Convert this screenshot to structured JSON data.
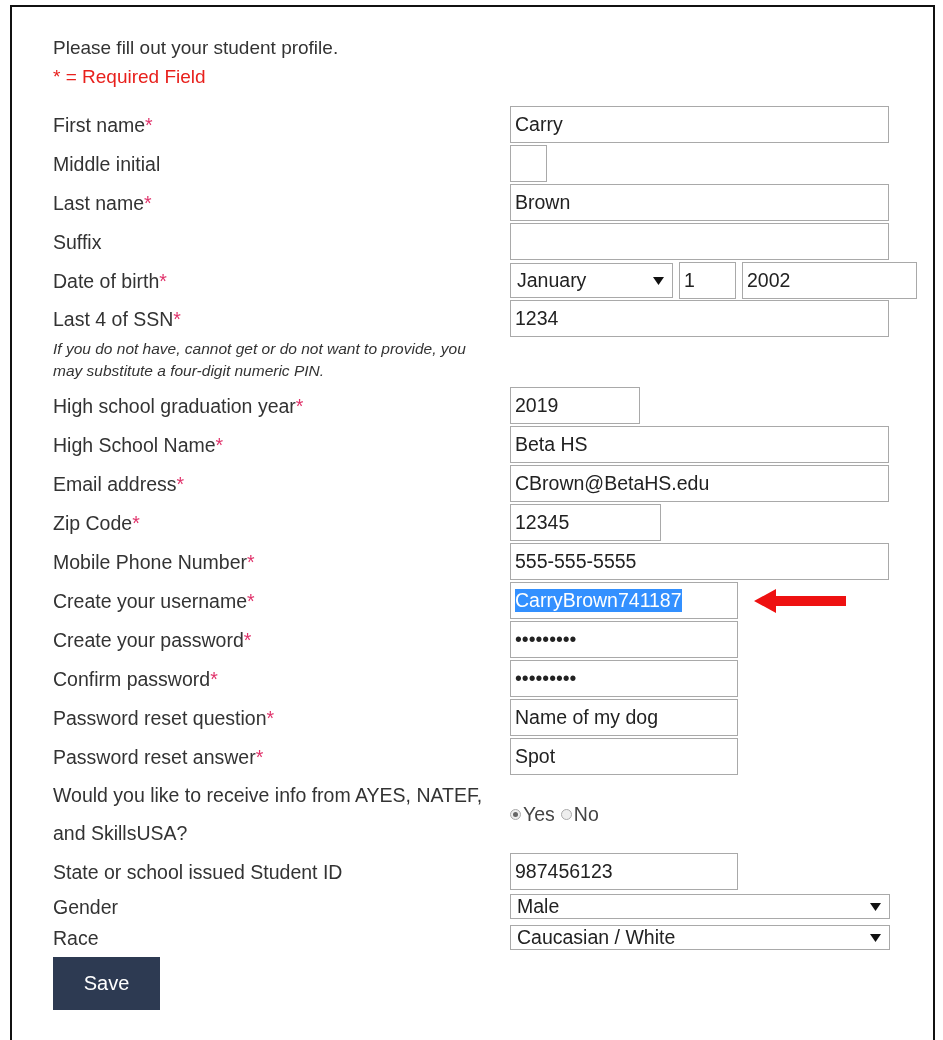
{
  "intro": "Please fill out your student profile.",
  "legend": "* = Required Field",
  "rows": [
    {
      "kind": "text",
      "label": "First name",
      "marker": "*",
      "value": "Carry"
    },
    {
      "kind": "text",
      "label": "Middle initial"
    },
    {
      "kind": "text",
      "label": "Last name",
      "marker": "*",
      "value": "Brown"
    },
    {
      "kind": "text",
      "label": "Suffix"
    },
    {
      "kind": "date",
      "label": "Date of birth",
      "marker": "*",
      "month": "January",
      "day": "1",
      "year": "2002"
    },
    {
      "kind": "text",
      "label": "Last 4 of SSN",
      "marker": "*",
      "note": "If you do not have, cannot get or do not want to provide, you may substitute a four-digit numeric PIN.",
      "value": "1234"
    },
    {
      "kind": "text",
      "label": "High school graduation year",
      "marker": "*",
      "value": "2019"
    },
    {
      "kind": "text",
      "label": "High School Name",
      "marker": "*",
      "value": "Beta HS"
    },
    {
      "kind": "text",
      "label": "Email address",
      "marker": "*",
      "value": "CBrown@BetaHS.edu"
    },
    {
      "kind": "text",
      "label": "Zip Code",
      "marker": "*",
      "value": "12345"
    },
    {
      "kind": "text",
      "label": "Mobile Phone Number",
      "marker": "*",
      "value": "555-555-5555"
    },
    {
      "kind": "text",
      "label": "Create your username",
      "marker": "*",
      "value": "CarryBrown741187",
      "highlighted": true
    },
    {
      "kind": "text",
      "label": "Create your password",
      "marker": "*",
      "value": "•••••••••"
    },
    {
      "kind": "text",
      "label": "Confirm password",
      "marker": "*",
      "value": "•••••••••"
    },
    {
      "kind": "text",
      "label": "Password reset question",
      "marker": "*",
      "value": "Name of my dog"
    },
    {
      "kind": "text",
      "label": "Password reset answer",
      "marker": "*",
      "value": "Spot"
    },
    {
      "kind": "radio",
      "label": "Would you like to receive info from AYES, NATEF, and SkillsUSA?",
      "options": [
        {
          "label": "Yes",
          "selected": true
        },
        {
          "label": "No",
          "selected": false
        }
      ]
    },
    {
      "kind": "text",
      "label": "State or school issued Student ID",
      "value": "987456123"
    },
    {
      "kind": "select",
      "label": "Gender",
      "value": "Male"
    },
    {
      "kind": "select",
      "label": "Race",
      "value": "Caucasian / White"
    }
  ],
  "save_button": "Save"
}
